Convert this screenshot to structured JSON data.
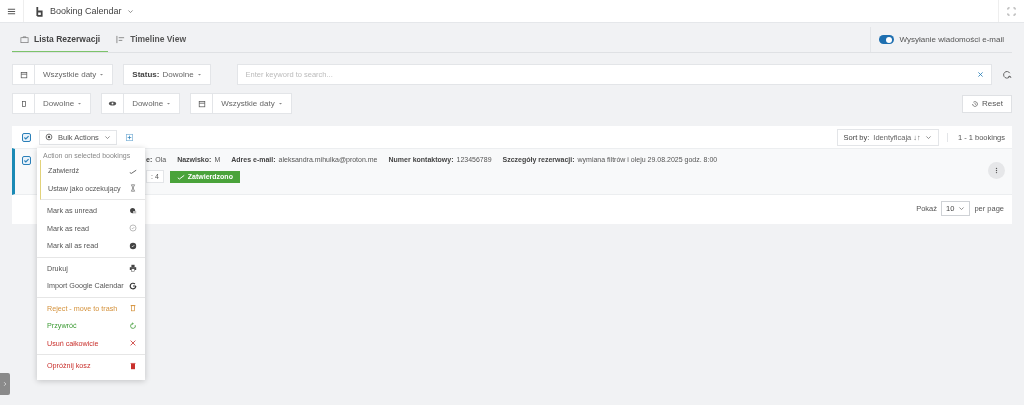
{
  "header": {
    "title": "Booking Calendar"
  },
  "tabs": [
    {
      "label": "Lista Rezerwacji",
      "selected": true
    },
    {
      "label": "Timeline View",
      "selected": false
    }
  ],
  "email_toggle": {
    "label": "Wysyłanie wiadomości e-mail",
    "on": true
  },
  "filters": {
    "dates": "Wszystkie daty",
    "status_label": "Status:",
    "status": "Dowolne",
    "search": {
      "placeholder": "Enter keyword to search..."
    }
  },
  "filters2": [
    "Dowolne",
    "Dowolne",
    "Wszystkie daty"
  ],
  "reset": "Reset",
  "list": {
    "select_all_checked": true,
    "bulk_actions": "Bulk Actions",
    "sort_label": "Sort by:",
    "sort_value": "Identyficaja ↓↑",
    "count": "1 - 1 bookings",
    "bookings": [
      {
        "checked": true,
        "fields": [
          {
            "label": "e:",
            "value": "Ola"
          },
          {
            "label": "Nazwisko:",
            "value": "M"
          },
          {
            "label": "Adres e-mail:",
            "value": "aleksandra.mihulka@proton.me"
          },
          {
            "label": "Numer kontaktowy:",
            "value": "123456789"
          },
          {
            "label": "Szczegóły rezerwacji:",
            "value": "wymiana filtrów i oleju 29.08.2025 godz. 8:00"
          }
        ],
        "resource": ": 4",
        "status": {
          "label": "Zatwierdzono",
          "kind": "approved"
        }
      }
    ],
    "pagination": {
      "label": "Pokaż",
      "per_page": "10",
      "suffix": "per page"
    }
  },
  "bulk_menu": {
    "heading": "Action on selected bookings",
    "groups": [
      [
        {
          "label": "Zatwierdź",
          "kind": "normal"
        },
        {
          "label": "Ustaw jako oczekujący",
          "kind": "normal"
        }
      ],
      [
        {
          "label": "Mark as unread",
          "kind": "normal"
        },
        {
          "label": "Mark as read",
          "kind": "normal"
        },
        {
          "label": "Mark all as read",
          "kind": "normal"
        }
      ],
      [
        {
          "label": "Drukuj",
          "kind": "normal"
        },
        {
          "label": "Import Google Calendar",
          "kind": "normal"
        }
      ],
      [
        {
          "label": "Reject - move to trash",
          "kind": "warning"
        },
        {
          "label": "Przywróć",
          "kind": "restore"
        },
        {
          "label": "Usuń całkowicie",
          "kind": "danger"
        }
      ],
      [
        {
          "label": "Opróżnij kosz",
          "kind": "danger"
        }
      ]
    ]
  }
}
